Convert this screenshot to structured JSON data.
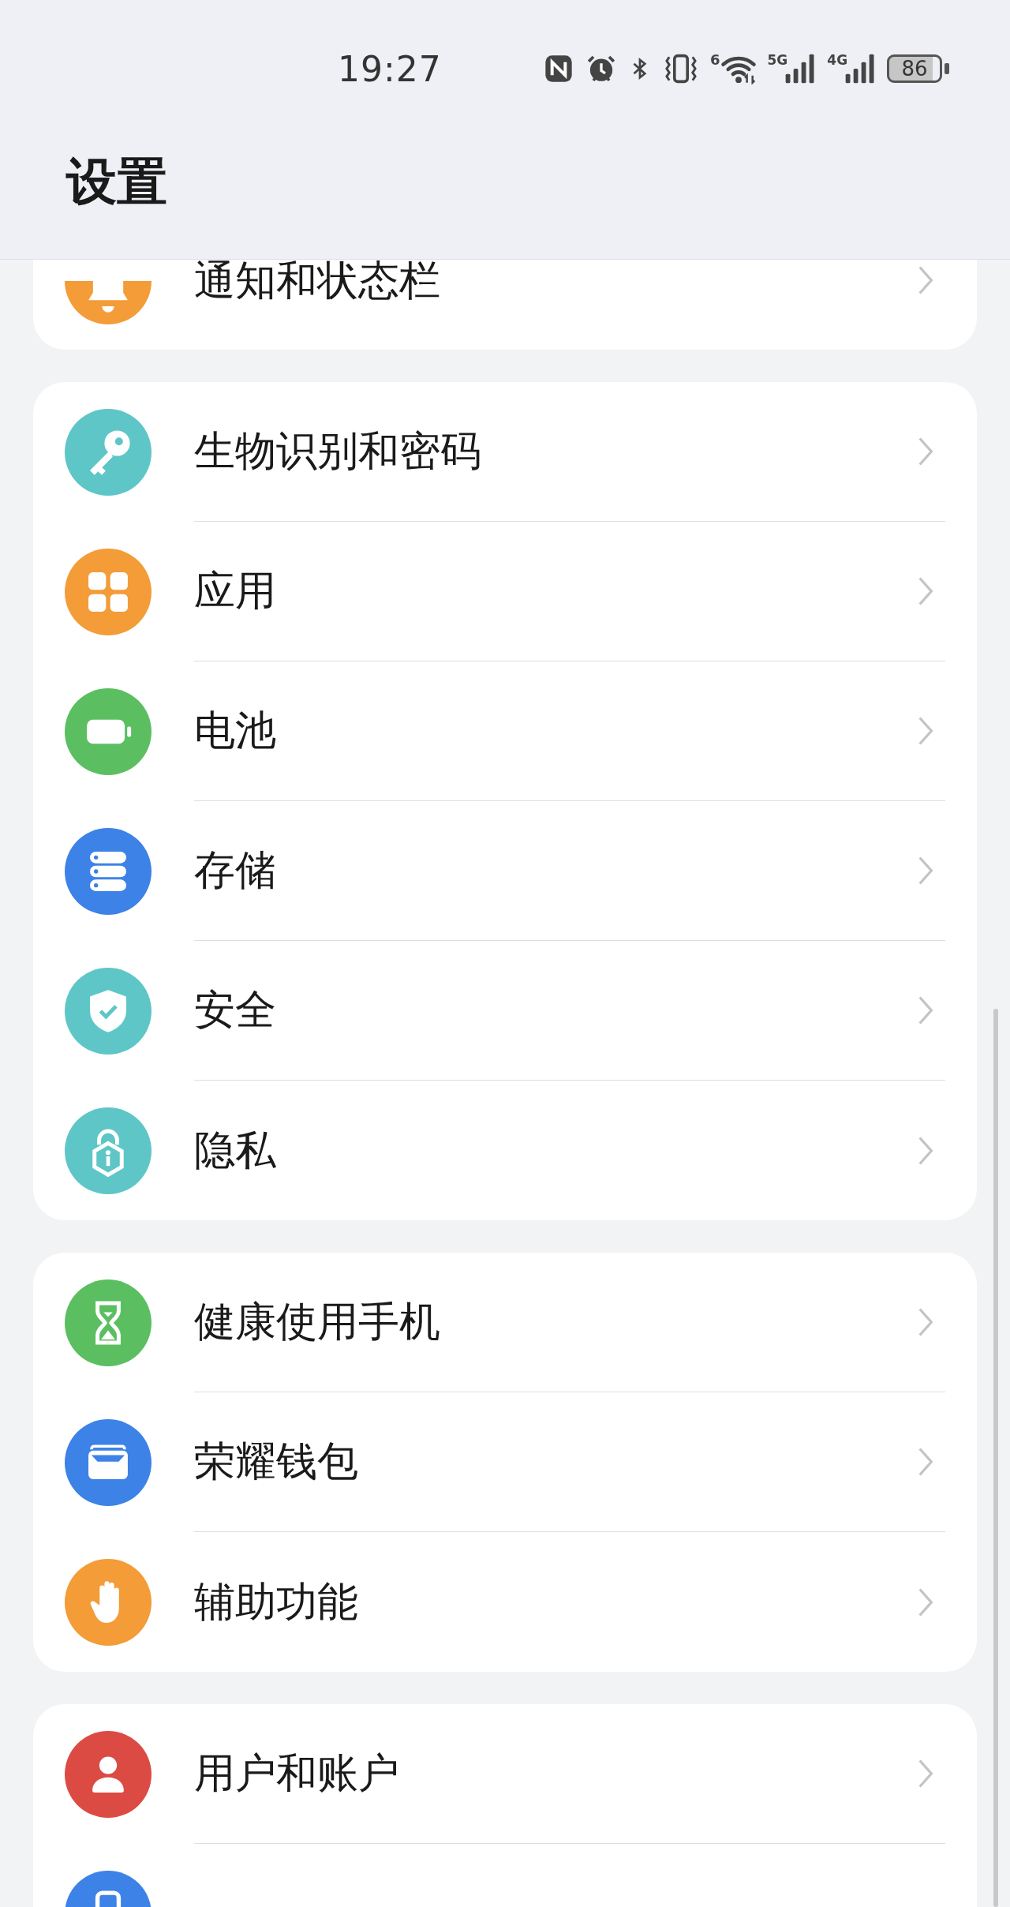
{
  "status_bar": {
    "time": "19:27",
    "wifi_label": "6",
    "signals": [
      "5G",
      "4G"
    ],
    "battery": "86"
  },
  "header": {
    "title": "设置"
  },
  "groups": [
    {
      "items": [
        {
          "label": "通知和状态栏",
          "color": "#f39c38"
        }
      ]
    },
    {
      "items": [
        {
          "label": "生物识别和密码",
          "color": "#5ec6c6"
        },
        {
          "label": "应用",
          "color": "#f39c38"
        },
        {
          "label": "电池",
          "color": "#5bbf62"
        },
        {
          "label": "存储",
          "color": "#3d82e6"
        },
        {
          "label": "安全",
          "color": "#5ec6c6"
        },
        {
          "label": "隐私",
          "color": "#5ec6c6"
        }
      ]
    },
    {
      "items": [
        {
          "label": "健康使用手机",
          "color": "#5bbf62"
        },
        {
          "label": "荣耀钱包",
          "color": "#3d82e6"
        },
        {
          "label": "辅助功能",
          "color": "#f39c38"
        }
      ]
    },
    {
      "items": [
        {
          "label": "用户和账户",
          "color": "#dc4b43"
        },
        {
          "color": "#3d82e6"
        }
      ]
    }
  ]
}
